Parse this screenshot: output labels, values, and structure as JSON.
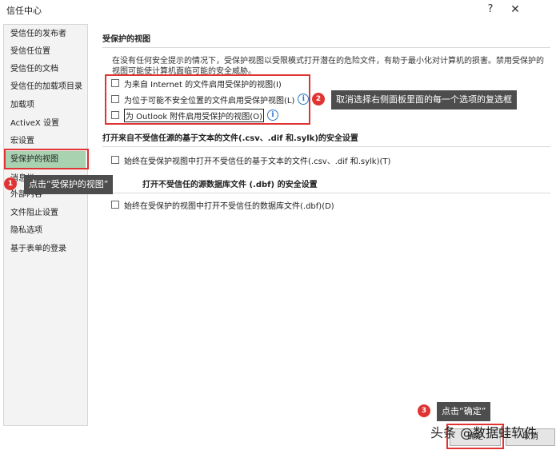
{
  "window": {
    "title": "信任中心",
    "help_label": "?",
    "close_label": "✕"
  },
  "sidebar": {
    "items": [
      {
        "label": "受信任的发布者"
      },
      {
        "label": "受信任位置"
      },
      {
        "label": "受信任的文档"
      },
      {
        "label": "受信任的加载项目录"
      },
      {
        "label": "加载项"
      },
      {
        "label": "ActiveX 设置"
      },
      {
        "label": "宏设置"
      },
      {
        "label": "受保护的视图",
        "selected": true
      },
      {
        "label": "消息栏"
      },
      {
        "label": "外部内容"
      },
      {
        "label": "文件阻止设置"
      },
      {
        "label": "隐私选项"
      },
      {
        "label": "基于表单的登录"
      }
    ]
  },
  "main": {
    "section1_title": "受保护的视图",
    "section1_desc": "在没有任何安全提示的情况下，受保护视图以受限模式打开潜在的危险文件，有助于最小化对计算机的损害。禁用受保护的视图可能使计算机面临可能的安全威胁。",
    "options": [
      {
        "label": "为来自 Internet 的文件启用受保护的视图(I)",
        "checked": false
      },
      {
        "label": "为位于可能不安全位置的文件启用受保护视图(L)",
        "checked": false
      },
      {
        "label": "为 Outlook 附件启用受保护的视图(O)",
        "checked": false
      }
    ],
    "section2_title": "打开来自不受信任源的基于文本的文件(.csv、.dif 和.sylk)的安全设置",
    "section2_option": "始终在受保护视图中打开不受信任的基于文本的文件(.csv、.dif 和.sylk)(T)",
    "section3_title": "打开不受信任的源数据库文件 (.dbf) 的安全设置",
    "section3_option": "始终在受保护的视图中打开不受信任的数据库文件(.dbf)(D)"
  },
  "annotations": {
    "step1": {
      "badge": "1",
      "text": "点击“受保护的视图”"
    },
    "step2": {
      "badge": "2",
      "text": "取消选择右侧面板里面的每一个选项的复选框"
    },
    "step3": {
      "badge": "3",
      "text": "点击“确定”"
    }
  },
  "footer": {
    "ok_label": "确定",
    "cancel_label": "取消"
  },
  "watermark": "头条 @数据蛙软件",
  "colors": {
    "selected_bg": "#a9d2b1",
    "annotation_red": "#e03333",
    "callout_bg": "#4d4d4d",
    "info_blue": "#2f78c4"
  }
}
